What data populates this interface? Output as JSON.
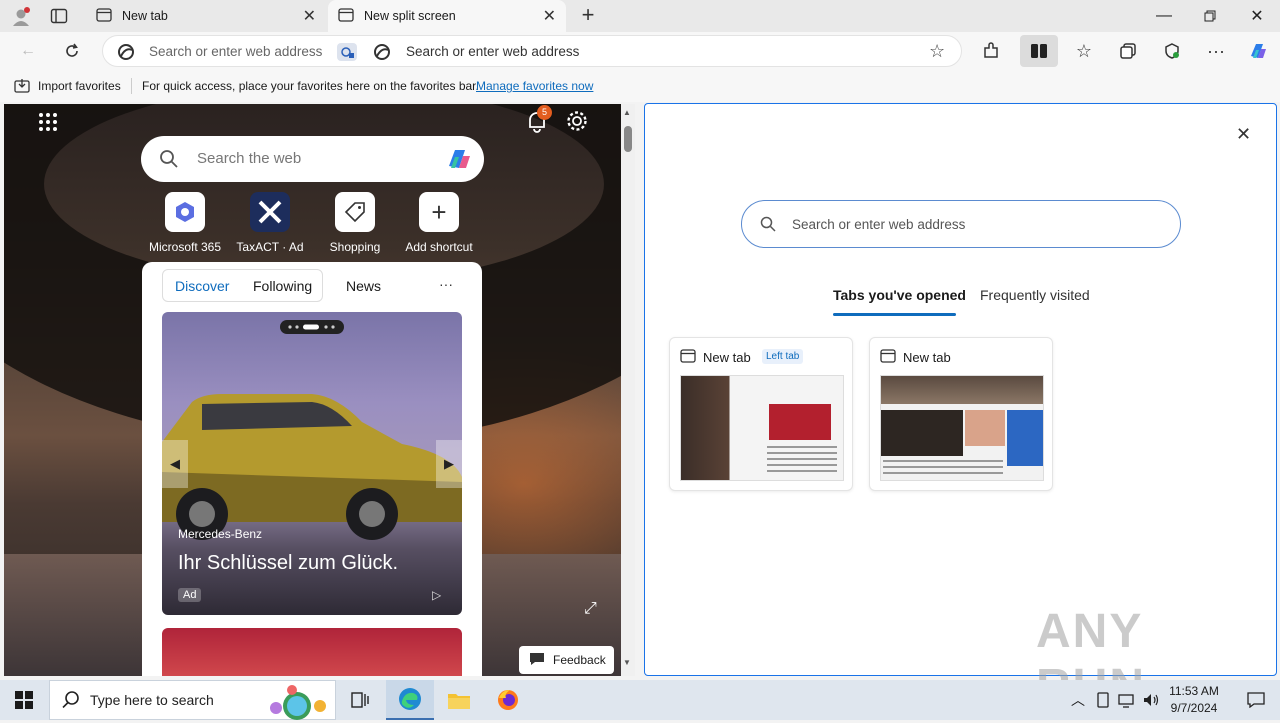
{
  "tabs": [
    {
      "label": "New tab",
      "active": false
    },
    {
      "label": "New split screen",
      "active": true
    }
  ],
  "toolbar": {
    "left_address_placeholder": "Search or enter web address",
    "right_address_placeholder": "Search or enter web address"
  },
  "favbar": {
    "import_label": "Import favorites",
    "message": "For quick access, place your favorites here on the favorites bar.",
    "manage_link": "Manage favorites now"
  },
  "leftpane": {
    "notification_count": "5",
    "search_placeholder": "Search the web",
    "shortcuts": [
      {
        "label": "Microsoft 365"
      },
      {
        "label": "TaxACT · Ad"
      },
      {
        "label": "Shopping"
      },
      {
        "label": "Add shortcut"
      }
    ],
    "feed_tabs": [
      {
        "label": "Discover",
        "active": true
      },
      {
        "label": "Following",
        "active": false
      },
      {
        "label": "News",
        "active": false
      }
    ],
    "more_label": "···",
    "ad": {
      "brand": "Mercedes-Benz",
      "headline": "Ihr Schlüssel zum Glück.",
      "badge": "Ad"
    },
    "feedback_label": "Feedback"
  },
  "rightpane": {
    "search_placeholder": "Search or enter web address",
    "tabs": [
      {
        "label": "Tabs you've opened",
        "active": true
      },
      {
        "label": "Frequently visited",
        "active": false
      }
    ],
    "cards": [
      {
        "title": "New tab",
        "badge": "Left tab"
      },
      {
        "title": "New tab",
        "badge": ""
      }
    ]
  },
  "taskbar": {
    "search_placeholder": "Type here to search",
    "time": "11:53 AM",
    "date": "9/7/2024"
  },
  "watermark": "ANY RUN",
  "colors": {
    "accent": "#1a73e8",
    "link": "#0f6cbd",
    "notification": "#e35d1f"
  }
}
